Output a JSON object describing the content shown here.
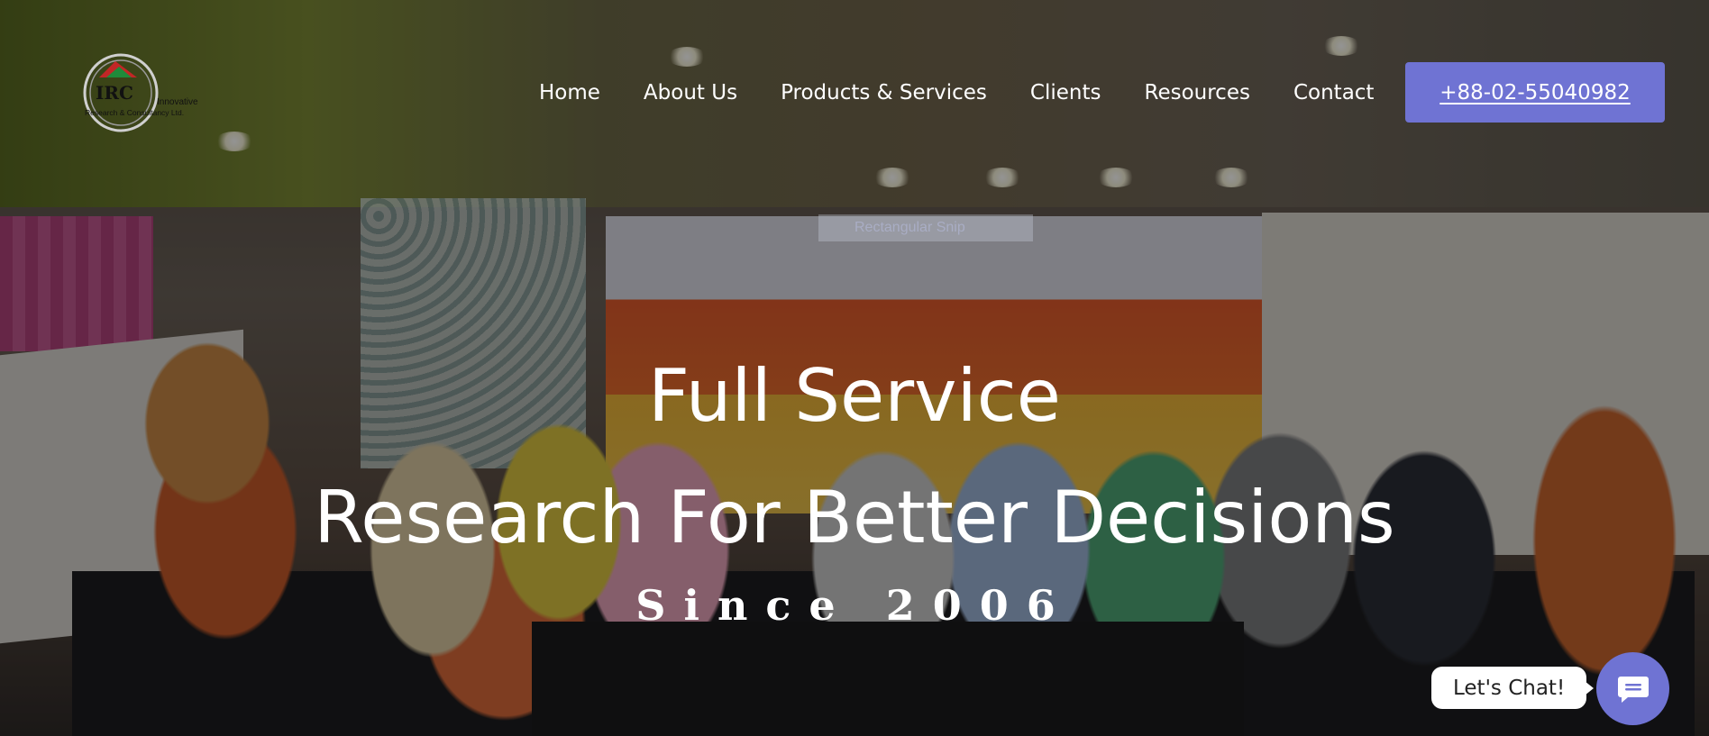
{
  "brand": {
    "logo_mark": "IRC",
    "logo_text_line1": "Innovative",
    "logo_text_line2": "Research & Consultancy Ltd."
  },
  "nav": {
    "items": [
      {
        "label": "Home"
      },
      {
        "label": "About Us"
      },
      {
        "label": "Products & Services"
      },
      {
        "label": "Clients"
      },
      {
        "label": "Resources"
      },
      {
        "label": "Contact"
      }
    ],
    "phone_label": "+88-02-55040982"
  },
  "hero": {
    "title": "Full Service",
    "subtitle": "Research For Better Decisions",
    "tagline": "Since 2006",
    "snip_text": "Rectangular Snip"
  },
  "chat": {
    "label": "Let's Chat!",
    "icon": "chat-icon"
  },
  "colors": {
    "accent": "#6f73d3",
    "overlay": "rgba(0,0,0,0.42)"
  }
}
